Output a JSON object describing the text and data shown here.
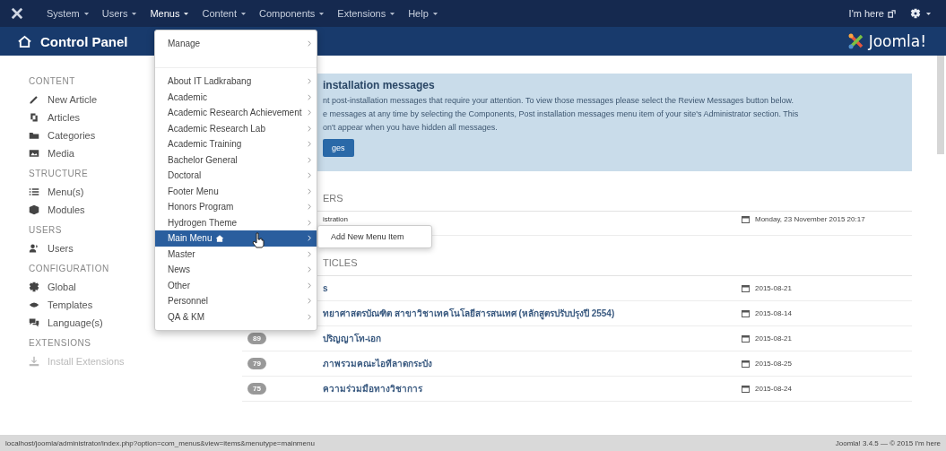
{
  "top_nav": {
    "items": [
      {
        "label": "System",
        "selected": false
      },
      {
        "label": "Users",
        "selected": false
      },
      {
        "label": "Menus",
        "selected": true
      },
      {
        "label": "Content",
        "selected": false
      },
      {
        "label": "Components",
        "selected": false
      },
      {
        "label": "Extensions",
        "selected": false
      },
      {
        "label": "Help",
        "selected": false
      }
    ],
    "site_link": "I'm here"
  },
  "header": {
    "title": "Control Panel",
    "brand": "Joomla!"
  },
  "sidebar": {
    "sections": [
      {
        "heading": "CONTENT",
        "items": [
          {
            "label": "New Article",
            "disabled": false
          },
          {
            "label": "Articles",
            "disabled": false
          },
          {
            "label": "Categories",
            "disabled": false
          },
          {
            "label": "Media",
            "disabled": false
          }
        ]
      },
      {
        "heading": "STRUCTURE",
        "items": [
          {
            "label": "Menu(s)",
            "disabled": false
          },
          {
            "label": "Modules",
            "disabled": false
          }
        ]
      },
      {
        "heading": "USERS",
        "items": [
          {
            "label": "Users",
            "disabled": false
          }
        ]
      },
      {
        "heading": "CONFIGURATION",
        "items": [
          {
            "label": "Global",
            "disabled": false
          },
          {
            "label": "Templates",
            "disabled": false
          },
          {
            "label": "Language(s)",
            "disabled": false
          }
        ]
      },
      {
        "heading": "EXTENSIONS",
        "items": [
          {
            "label": "Install Extensions",
            "disabled": true
          }
        ]
      }
    ]
  },
  "alert": {
    "title": "installation messages",
    "lines": [
      "nt post-installation messages that require your attention. To view those messages please select the Review Messages button below.",
      "e messages at any time by selecting the Components, Post installation messages menu item of your site's Administrator section. This",
      "on't appear when you have hidden all messages."
    ],
    "button": "ges"
  },
  "users_panel": {
    "heading": "ERS",
    "rows": [
      {
        "name": "istration",
        "date": "Monday, 23 November 2015 20:17"
      }
    ]
  },
  "articles_panel": {
    "heading": "TICLES",
    "rows": [
      {
        "hits": null,
        "title": "s",
        "date": "2015-08-21"
      },
      {
        "hits": null,
        "title": "ทยาศาสตรบัณฑิต สาขาวิชาเทคโนโลยีสารสนเทศ (หลักสูตรปรับปรุงปี 2554)",
        "date": "2015-08-14"
      },
      {
        "hits": "89",
        "title": "ปริญญาโท-เอก",
        "date": "2015-08-21"
      },
      {
        "hits": "79",
        "title": "ภาพรวมคณะไอทีลาดกระบัง",
        "date": "2015-08-25"
      },
      {
        "hits": "75",
        "title": "ความร่วมมือทางวิชาการ",
        "date": "2015-08-24"
      }
    ]
  },
  "menus_dropdown": {
    "items": [
      {
        "label": "Manage",
        "selected": false,
        "is_default": false
      },
      {
        "label": "About IT Ladkrabang",
        "selected": false,
        "is_default": false
      },
      {
        "label": "Academic",
        "selected": false,
        "is_default": false
      },
      {
        "label": "Academic Research Achievement",
        "selected": false,
        "is_default": false
      },
      {
        "label": "Academic Research Lab",
        "selected": false,
        "is_default": false
      },
      {
        "label": "Academic Training",
        "selected": false,
        "is_default": false
      },
      {
        "label": "Bachelor General",
        "selected": false,
        "is_default": false
      },
      {
        "label": "Doctoral",
        "selected": false,
        "is_default": false
      },
      {
        "label": "Footer Menu",
        "selected": false,
        "is_default": false
      },
      {
        "label": "Honors Program",
        "selected": false,
        "is_default": false
      },
      {
        "label": "Hydrogen Theme",
        "selected": false,
        "is_default": false
      },
      {
        "label": "Main Menu",
        "selected": true,
        "is_default": true
      },
      {
        "label": "Master",
        "selected": false,
        "is_default": false
      },
      {
        "label": "News",
        "selected": false,
        "is_default": false
      },
      {
        "label": "Other",
        "selected": false,
        "is_default": false
      },
      {
        "label": "Personnel",
        "selected": false,
        "is_default": false
      },
      {
        "label": "QA & KM",
        "selected": false,
        "is_default": false
      }
    ],
    "submenu": {
      "item": "Add New Menu Item"
    }
  },
  "status_bar": {
    "url": "localhost/joomla/administrator/index.php?option=com_menus&view=items&menutype=mainmenu",
    "footer": "Joomla! 3.4.5 — © 2015 I'm here"
  }
}
